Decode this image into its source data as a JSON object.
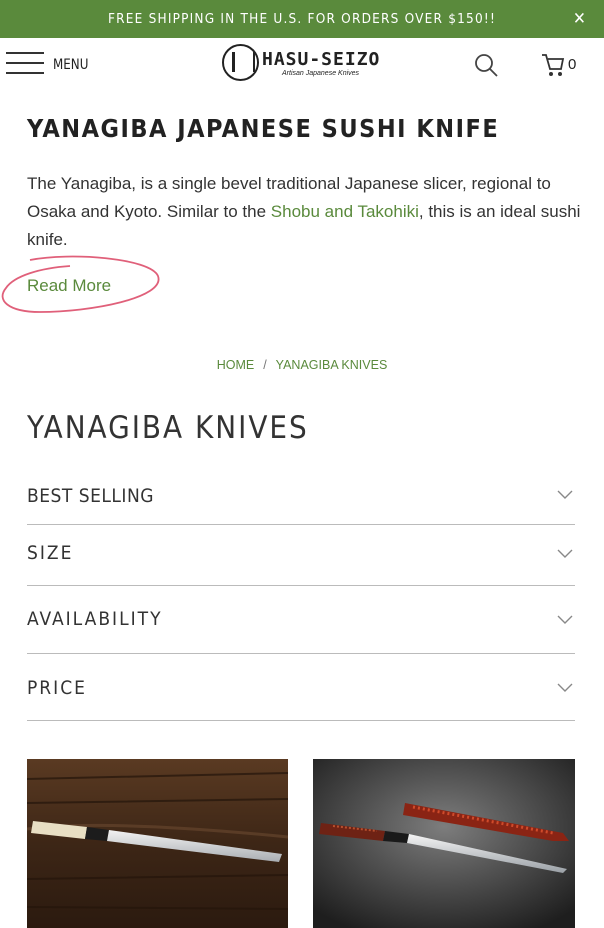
{
  "promo": {
    "text": "FREE SHIPPING IN THE U.S. FOR ORDERS OVER $150!!",
    "close": "✕"
  },
  "header": {
    "menu_label": "MENU",
    "logo_text": "HASU-SEIZO",
    "logo_sub": "Artisan Japanese Knives",
    "cart_count": "0",
    "icons": [
      "hamburger-icon",
      "search-icon",
      "cart-icon",
      "close-icon"
    ]
  },
  "hero": {
    "title": "YANAGIBA JAPANESE SUSHI KNIFE",
    "desc_pre": "The Yanagiba, is a single bevel traditional Japanese slicer, regional to Osaka and Kyoto. Similar to the ",
    "desc_link": "Shobu and Takohiki",
    "desc_post": ", this is an ideal sushi knife.",
    "read_more": "Read More"
  },
  "breadcrumb": {
    "home": "HOME",
    "sep": "/",
    "current": "YANAGIBA KNIVES"
  },
  "collection": {
    "title": "YANAGIBA KNIVES"
  },
  "filters": [
    {
      "label": "BEST SELLING"
    },
    {
      "label": "SIZE"
    },
    {
      "label": "AVAILABILITY"
    },
    {
      "label": "PRICE"
    }
  ],
  "colors": {
    "brand_green": "#5a8a3c",
    "annotation_red": "#e0607a"
  }
}
